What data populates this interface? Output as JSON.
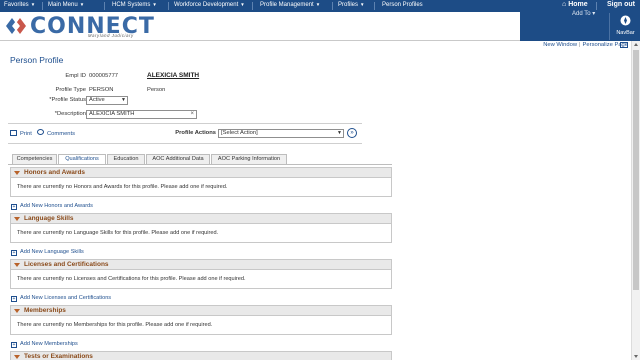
{
  "topbar": {
    "menus": [
      "Favorites",
      "Main Menu",
      "HCM Systems",
      "Workforce Development",
      "Profile Management",
      "Profiles",
      "Person Profiles"
    ],
    "home": "Home",
    "signout": "Sign out"
  },
  "banner": {
    "logo": "CONNECT",
    "subtitle": "Maryland Judiciary",
    "add_to": "Add To",
    "navbar": "NavBar"
  },
  "links": {
    "new_window": "New Window",
    "personalize": "Personalize Page"
  },
  "page_title": "Person Profile",
  "form": {
    "empl_id_label": "Empl ID",
    "empl_id": "000005777",
    "name": "ALEXICIA SMITH",
    "profile_type_label": "Profile Type",
    "profile_type": "PERSON",
    "profile_type_desc": "Person",
    "status_label": "*Profile Status",
    "status": "Active",
    "desc_label": "*Description",
    "desc": "ALEXICIA SMITH"
  },
  "actions": {
    "print": "Print",
    "comments": "Comments",
    "profile_actions_label": "Profile Actions",
    "profile_actions_value": "[Select Action]"
  },
  "tabs": [
    "Competencies",
    "Qualifications",
    "Education",
    "AOC Additional Data",
    "AOC Parking Information"
  ],
  "sections": [
    {
      "title": "Honors and Awards",
      "body": "There are currently no Honors and Awards for this profile.  Please add one if required.",
      "add": "Add New Honors and Awards"
    },
    {
      "title": "Language Skills",
      "body": "There are currently no Language Skills for this profile.  Please add one if required.",
      "add": "Add New Language Skills"
    },
    {
      "title": "Licenses and Certifications",
      "body": "There are currently no Licenses and Certifications for this profile.  Please add one if required.",
      "add": "Add New Licenses and Certifications"
    },
    {
      "title": "Memberships",
      "body": "There are currently no Memberships for this profile.  Please add one if required.",
      "add": "Add New Memberships"
    },
    {
      "title": "Tests or Examinations"
    }
  ],
  "colors": {
    "topbar": "#1d4c86",
    "link": "#1f4f8e",
    "section_title": "#8a4a1a"
  }
}
